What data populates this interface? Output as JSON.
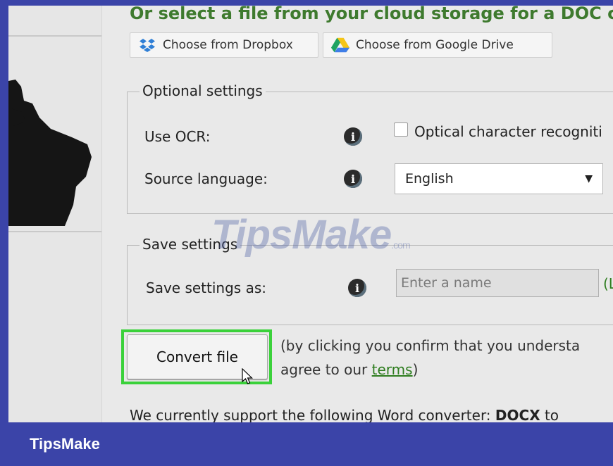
{
  "heading": "Or select a file from your cloud storage for a DOC c",
  "cloud": {
    "dropbox_label": "Choose from Dropbox",
    "gdrive_label": "Choose from Google Drive"
  },
  "optional": {
    "legend": "Optional settings",
    "ocr_label": "Use OCR:",
    "ocr_checkbox_label": "Optical character recogniti",
    "lang_label": "Source language:",
    "lang_value": "English"
  },
  "save": {
    "legend": "Save settings",
    "as_label": "Save settings as:",
    "name_placeholder": "Enter a name",
    "link_fragment": "(Lo"
  },
  "convert": {
    "button_label": "Convert file",
    "note_line1": "(by clicking you confirm that you understa",
    "note_line2_prefix": "agree to our ",
    "terms_link": "terms",
    "note_line2_suffix": ")"
  },
  "footer_text_prefix": "We currently support the following Word converter: ",
  "footer_text_bold": "DOCX",
  "footer_text_suffix": " to",
  "watermark": "TipsMake",
  "watermark_suffix": ".com",
  "brand": "TipsMake",
  "colors": {
    "accent_green": "#3ad13a",
    "heading_green": "#3e7a2e",
    "brand_bar": "#3b44a8"
  },
  "icons": {
    "dropbox": "dropbox-icon",
    "gdrive": "google-drive-icon",
    "info": "info-icon",
    "cursor": "mouse-pointer-icon"
  }
}
